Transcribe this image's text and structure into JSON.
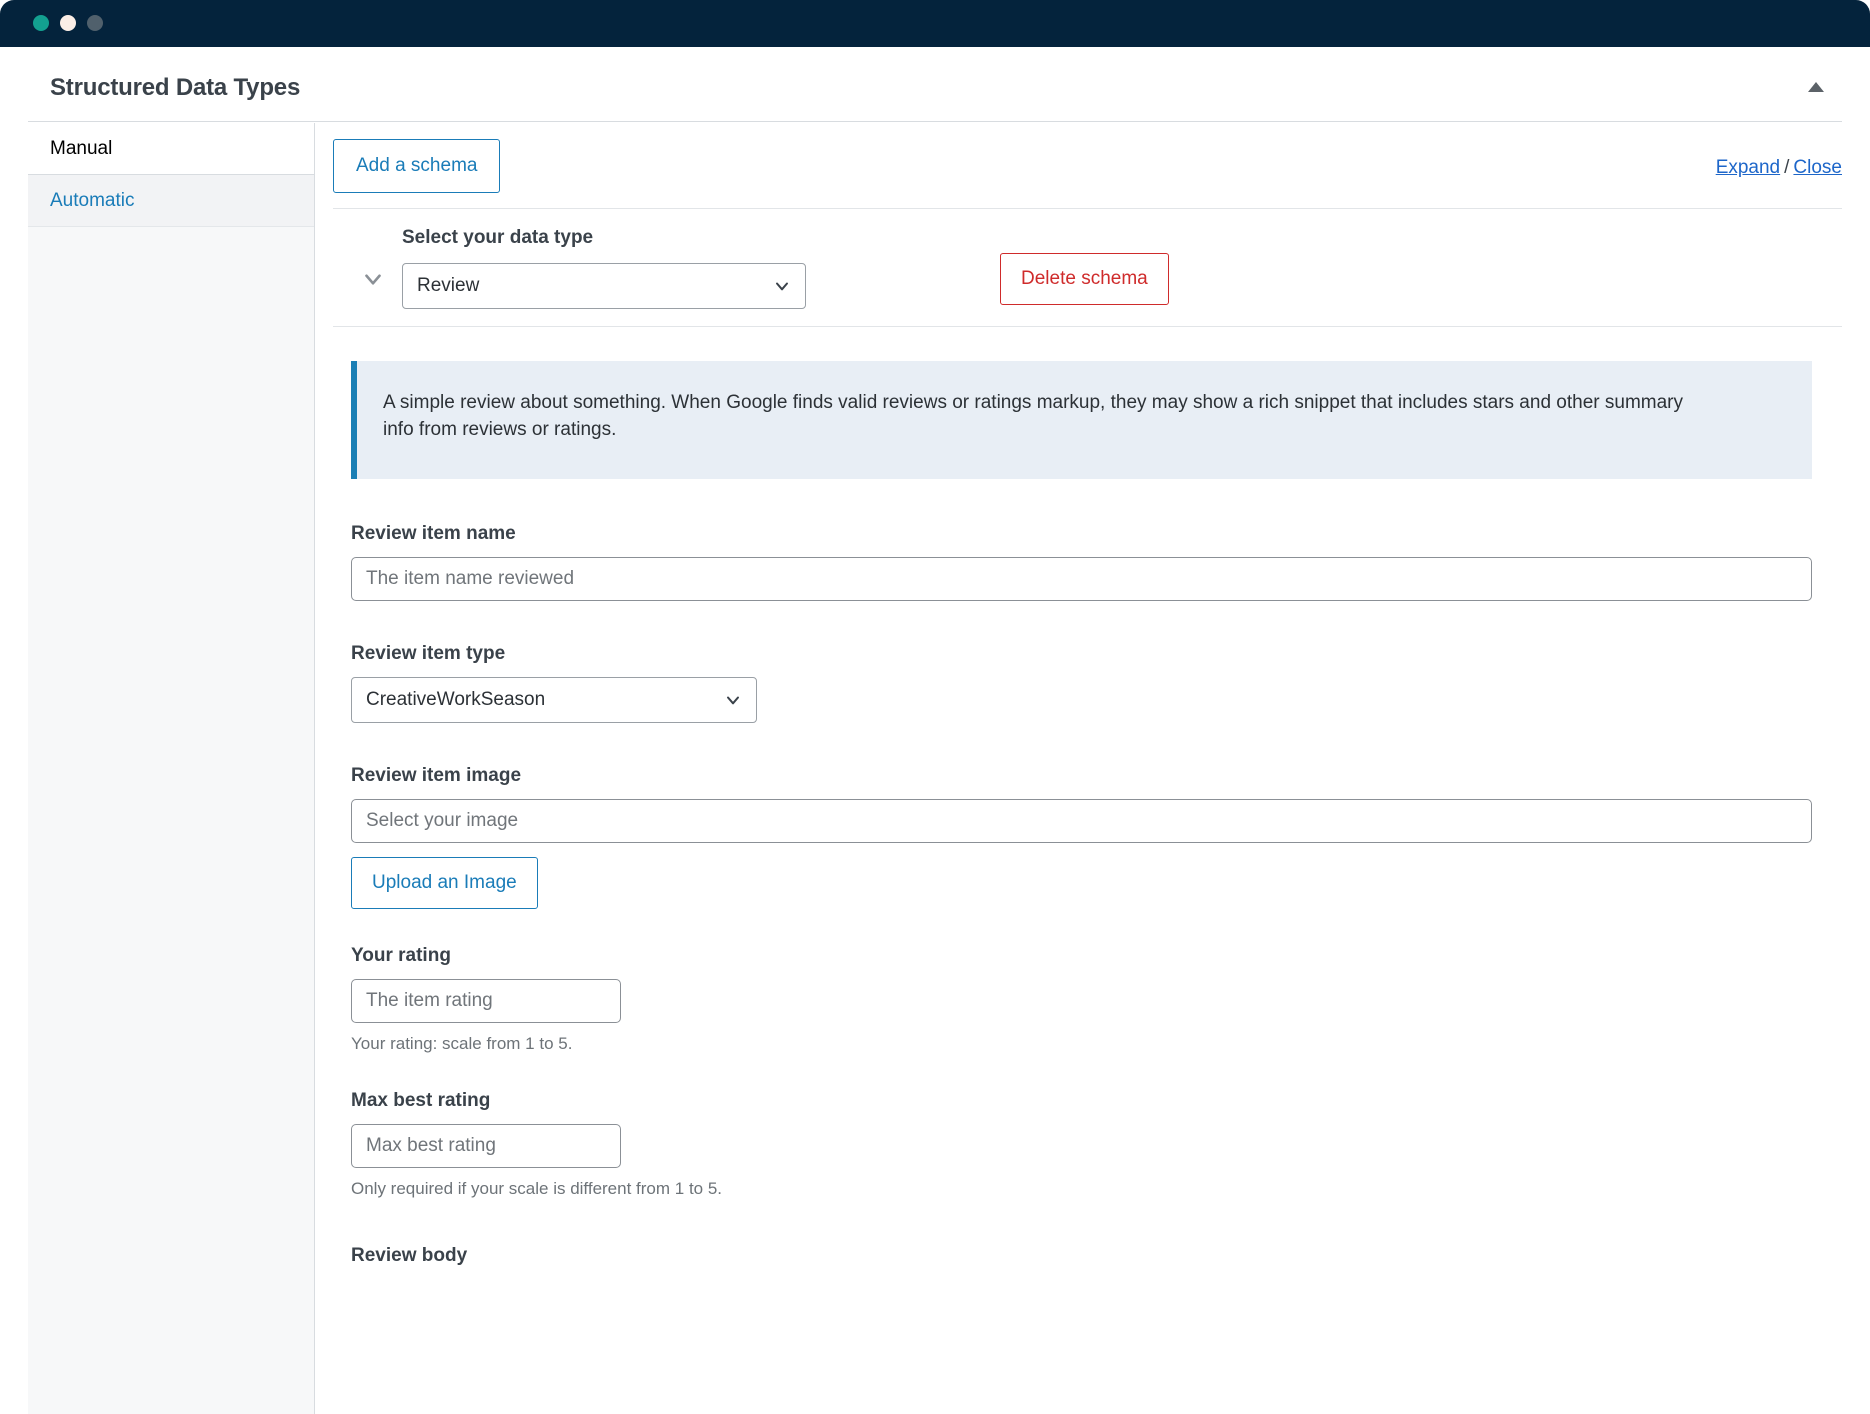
{
  "window": {
    "traffic_lights": [
      "close-dot",
      "minimize-dot",
      "maximize-dot"
    ],
    "colors": {
      "titlebar": "#04233c",
      "green_dot": "#13a090",
      "cream_dot": "#fbeee6",
      "slate_dot": "#50606c",
      "link_blue": "#1a7cb8",
      "underline_link_blue": "#1d66c9",
      "danger_red": "#cf2b2b",
      "notice_bg": "#e8eef5",
      "notice_border": "#1a7fb5"
    }
  },
  "panel": {
    "title": "Structured Data Types",
    "collapse_icon": "caret-up-icon"
  },
  "sidebar": {
    "items": [
      {
        "label": "Manual",
        "state": "active"
      },
      {
        "label": "Automatic",
        "state": "link"
      }
    ]
  },
  "toolbar": {
    "add_schema_label": "Add a schema",
    "expand_label": "Expand",
    "separator": "/",
    "close_label": "Close"
  },
  "schema": {
    "collapse_chevron": "chevron-down-icon",
    "data_type_label": "Select your data type",
    "data_type_value": "Review",
    "delete_label": "Delete schema",
    "notice": "A simple review about something. When Google finds valid reviews or ratings markup, they may show a rich snippet that includes stars and other summary info from reviews or ratings."
  },
  "form": {
    "item_name": {
      "label": "Review item name",
      "placeholder": "The item name reviewed",
      "value": ""
    },
    "item_type": {
      "label": "Review item type",
      "value": "CreativeWorkSeason"
    },
    "item_image": {
      "label": "Review item image",
      "placeholder": "Select your image",
      "value": "",
      "upload_label": "Upload an Image"
    },
    "your_rating": {
      "label": "Your rating",
      "placeholder": "The item rating",
      "value": "",
      "help": "Your rating: scale from 1 to 5."
    },
    "max_best_rating": {
      "label": "Max best rating",
      "placeholder": "Max best rating",
      "value": "",
      "help": "Only required if your scale is different from 1 to 5."
    },
    "review_body": {
      "label": "Review body"
    }
  }
}
